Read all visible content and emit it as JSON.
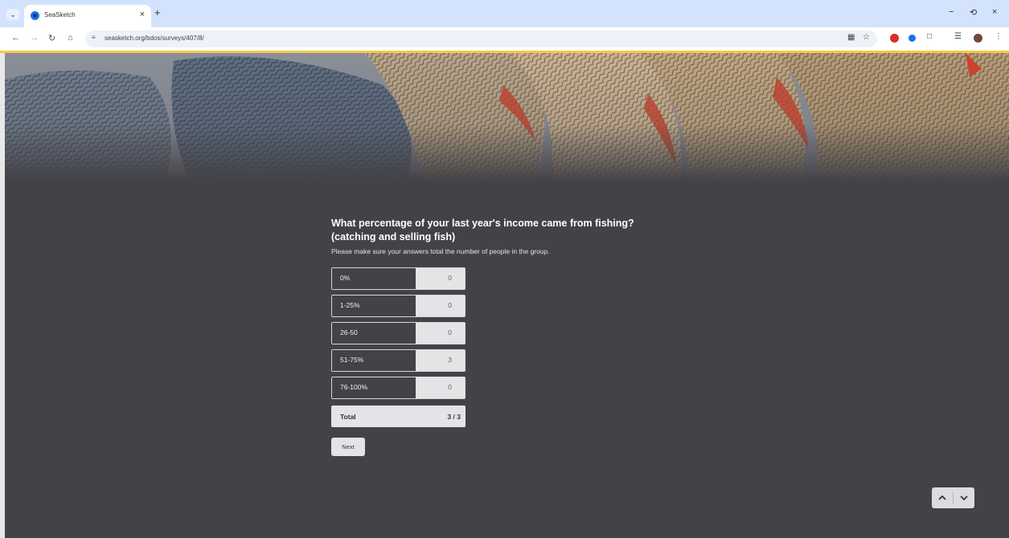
{
  "browser": {
    "tab_title": "SeaSketch",
    "tab_close": "×",
    "new_tab": "+",
    "tab_menu": "⌄",
    "url": "seasketch.org/bdos/surveys/407/8/",
    "window_controls": {
      "minimize": "−",
      "restore": "⟲",
      "close": "×"
    }
  },
  "survey": {
    "question": "What percentage of your last year's income came from fishing? (catching and selling fish)",
    "hint": "Please make sure your answers total the number of people in the group.",
    "options": [
      {
        "label": "0%",
        "value": "0"
      },
      {
        "label": "1-25%",
        "value": "0"
      },
      {
        "label": "26-50",
        "value": "0"
      },
      {
        "label": "51-75%",
        "value": "3"
      },
      {
        "label": "76-100%",
        "value": "0"
      }
    ],
    "total_label": "Total",
    "total_value": "3 / 3",
    "next_label": "Next"
  },
  "colors": {
    "page_background": "#434246",
    "tab_strip": "#d3e3fd",
    "loading_bar": "#f5c94a",
    "input_fill": "#e4e3e5"
  },
  "icons": [
    "tab-menu-icon",
    "favicon",
    "back-icon",
    "forward-icon",
    "reload-icon",
    "home-icon",
    "site-info-icon",
    "cast-icon",
    "bookmark-star-icon",
    "extension-icon",
    "chevron-up-icon",
    "chevron-down-icon"
  ]
}
